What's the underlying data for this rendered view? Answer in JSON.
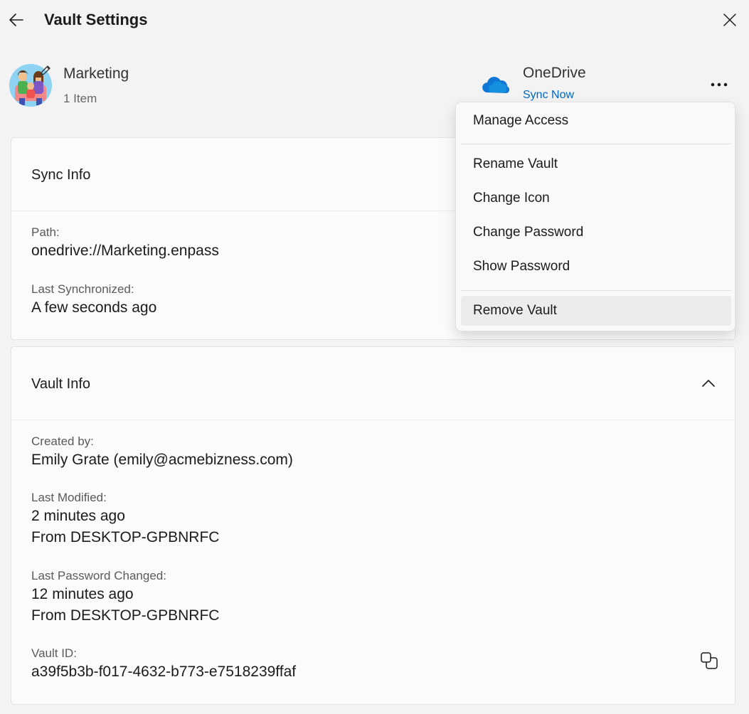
{
  "header": {
    "title": "Vault Settings"
  },
  "vault": {
    "name": "Marketing",
    "item_count": "1 Item",
    "provider": "OneDrive",
    "sync_action": "Sync Now"
  },
  "sync_info": {
    "title": "Sync Info",
    "path_label": "Path:",
    "path_value": "onedrive://Marketing.enpass",
    "last_sync_label": "Last Synchronized:",
    "last_sync_value": "A few seconds ago"
  },
  "vault_info": {
    "title": "Vault Info",
    "created_by_label": "Created by:",
    "created_by_value": "Emily Grate (emily@acmebizness.com)",
    "last_modified_label": "Last Modified:",
    "last_modified_value": "2 minutes ago",
    "last_modified_from": "From DESKTOP-GPBNRFC",
    "last_pw_changed_label": "Last Password Changed:",
    "last_pw_changed_value": "12 minutes ago",
    "last_pw_changed_from": "From DESKTOP-GPBNRFC",
    "vault_id_label": "Vault ID:",
    "vault_id_value": "a39f5b3b-f017-4632-b773-e7518239ffaf"
  },
  "menu": {
    "items": [
      "Manage Access",
      "Rename Vault",
      "Change Icon",
      "Change Password",
      "Show Password",
      "Remove Vault"
    ],
    "highlighted": "Remove Vault"
  },
  "colors": {
    "accent": "#0067c0",
    "background": "#f3f3f3",
    "card": "#fbfbfb"
  }
}
